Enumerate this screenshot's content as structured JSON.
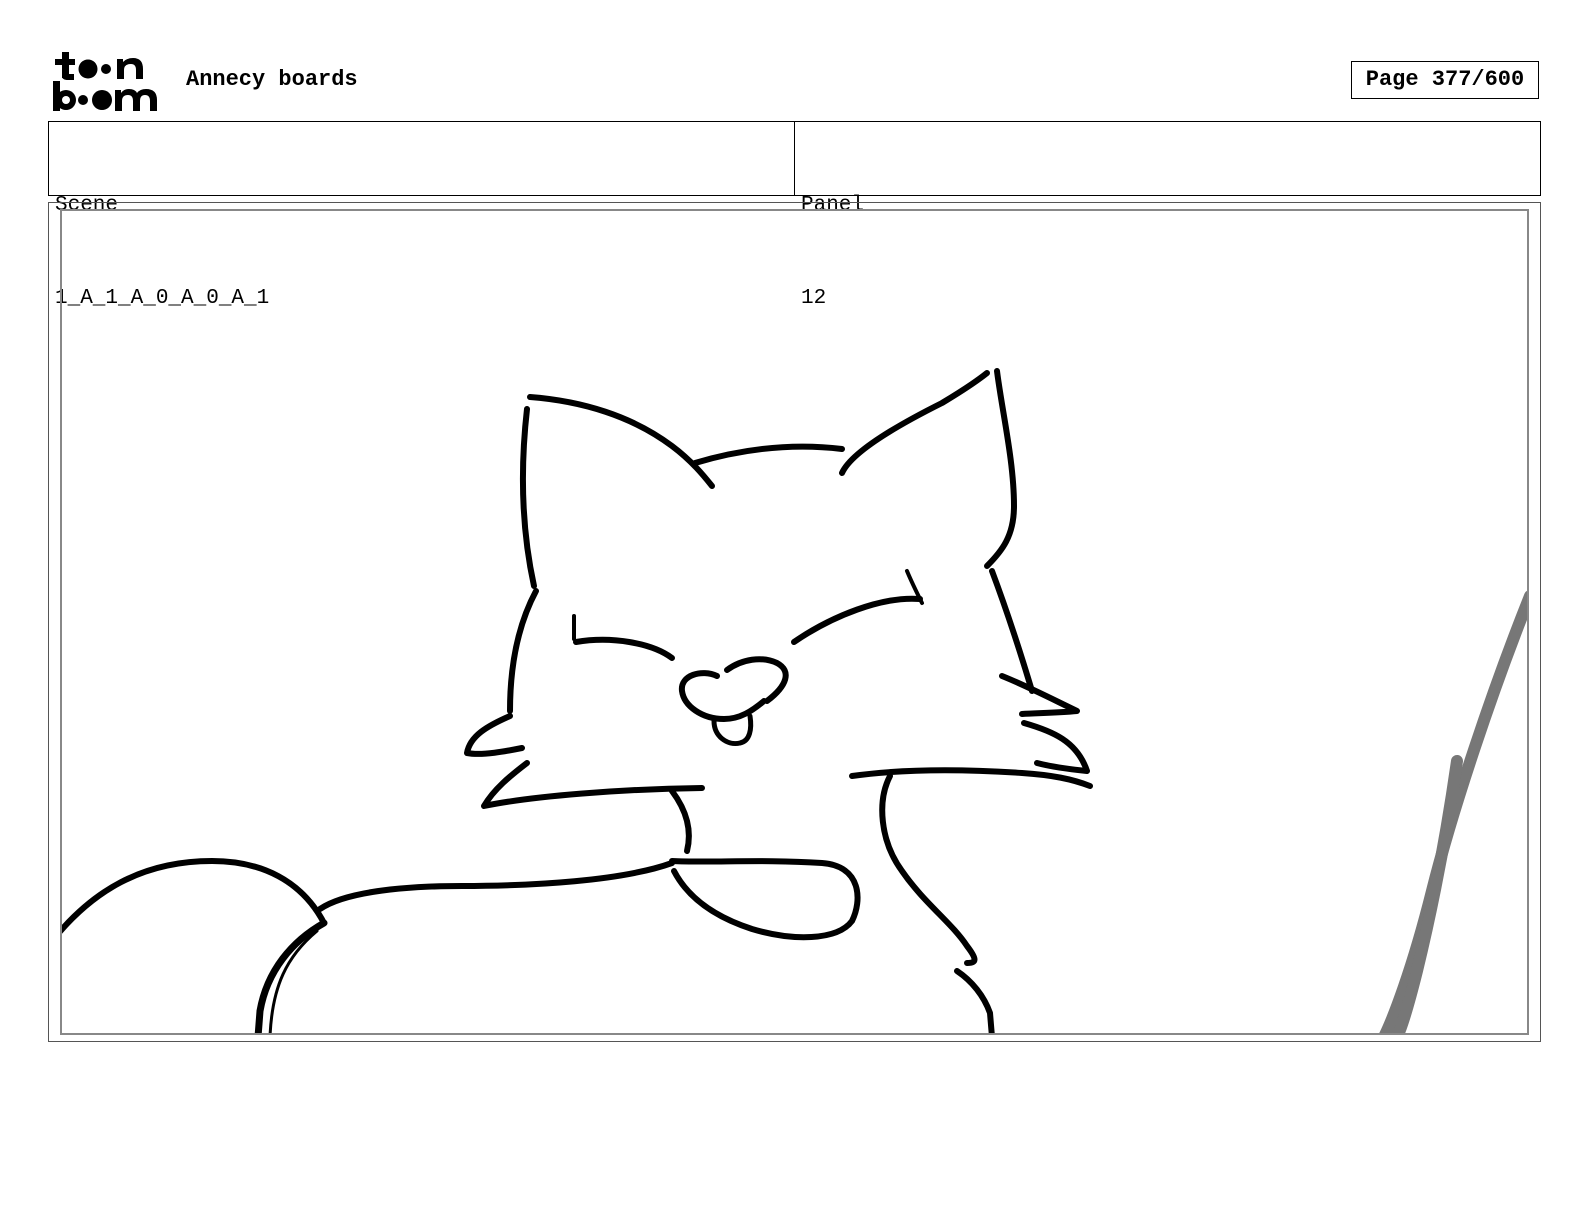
{
  "header": {
    "logo_text": "toon boom",
    "project_title": "Annecy boards",
    "page_label": "Page 377/600"
  },
  "info": {
    "scene_label": "Scene",
    "scene_value": "1_A_1_A_0_A_0_A_1",
    "panel_label": "Panel",
    "panel_value": "12"
  },
  "panel": {
    "drawing": "cat-sketch"
  }
}
